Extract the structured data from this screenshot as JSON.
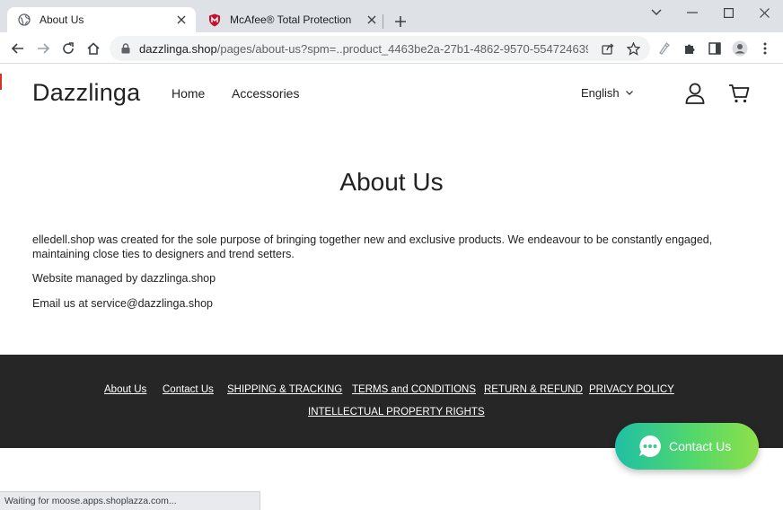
{
  "browser": {
    "tabs": [
      {
        "title": "About Us",
        "icon": "globe-icon",
        "active": true
      },
      {
        "title": "McAfee® Total Protection",
        "icon": "mcafee-shield-icon",
        "active": false
      }
    ],
    "address": {
      "host": "dazzlinga.shop",
      "path": "/pages/about-us?spm=..product_4463be2a-27b1-4862-9570-554724639223.f..."
    },
    "status_text": "Waiting for moose.apps.shoplazza.com..."
  },
  "site": {
    "logo": "Dazzlinga",
    "nav": [
      "Home",
      "Accessories"
    ],
    "language": "English"
  },
  "content": {
    "title": "About Us",
    "paragraphs": [
      "elledell.shop was created for the sole purpose of bringing together new and exclusive products. We endeavour to be constantly engaged, maintaining close ties to designers and trend setters.",
      "Website managed by dazzlinga.shop",
      "Email us at service@dazzlinga.shop"
    ]
  },
  "footer": {
    "links": [
      "About Us",
      "Contact Us",
      "SHIPPING & TRACKING",
      "TERMS and CONDITIONS",
      "RETURN & REFUND",
      "PRIVACY POLICY",
      "INTELLECTUAL PROPERTY RIGHTS"
    ]
  },
  "contact_widget": {
    "label": "Contact Us"
  },
  "colors": {
    "footer_bg": "#262626",
    "contact_gradient_start": "#1fbfa6",
    "contact_gradient_end": "#8fe04a",
    "tab_strip": "#dee1e6"
  }
}
